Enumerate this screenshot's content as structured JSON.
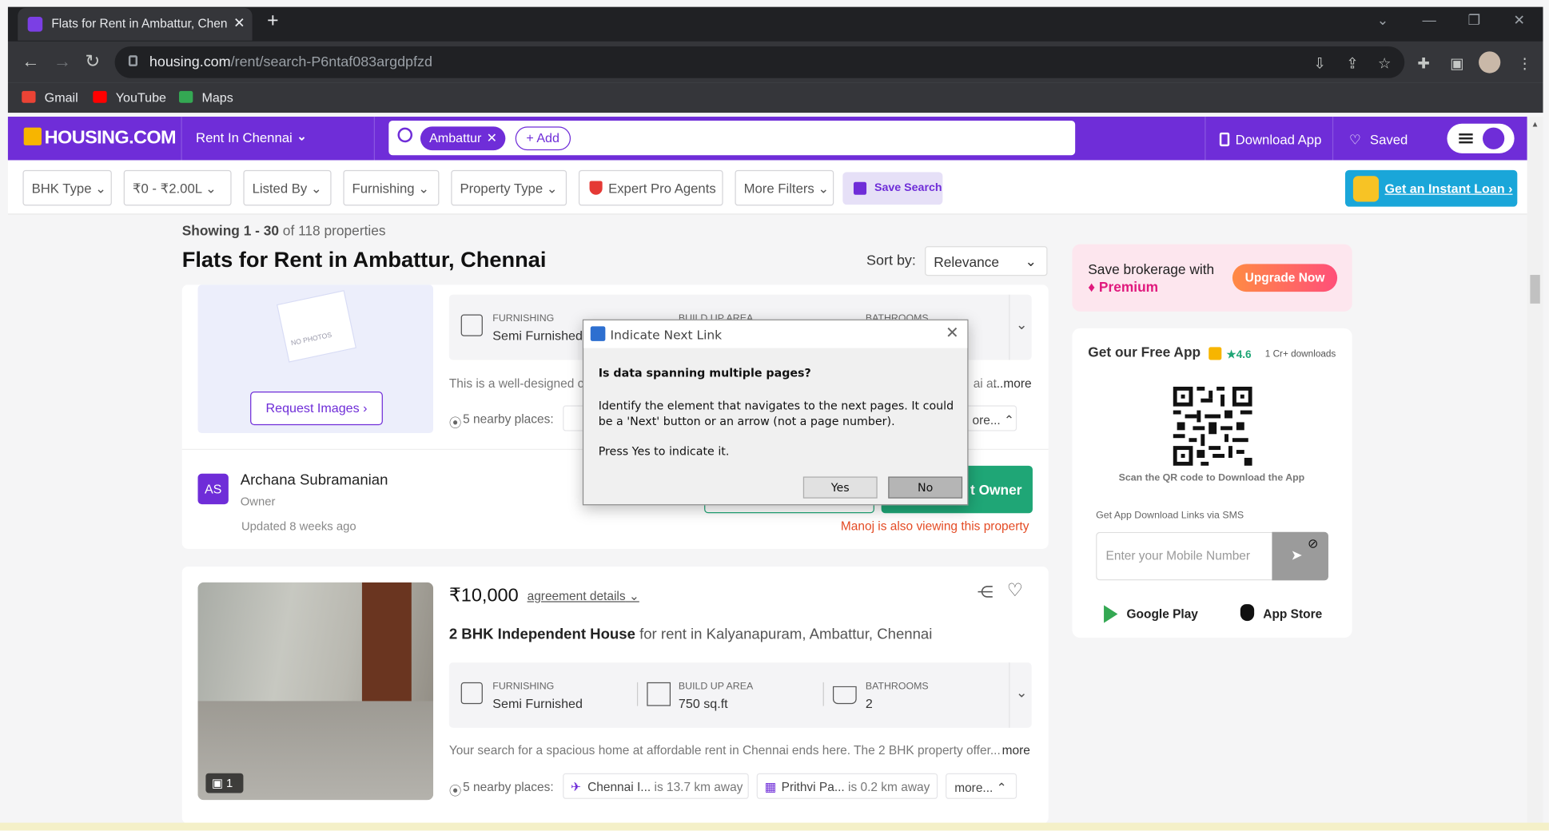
{
  "browser": {
    "tab_title": "Flats for Rent in Ambattur, Chenn",
    "url_host": "housing.com",
    "url_path": "/rent/search-P6ntaf083argdpfzd",
    "bookmarks": [
      "Gmail",
      "YouTube",
      "Maps"
    ]
  },
  "header": {
    "logo": "HOUSING.COM",
    "city": "Rent In Chennai",
    "search_chip": "Ambattur",
    "add_label": "+ Add",
    "download_app": "Download App",
    "saved": "Saved"
  },
  "filters": {
    "items": [
      "BHK Type",
      "₹0 - ₹2.00L",
      "Listed By",
      "Furnishing",
      "Property Type",
      "Expert Pro Agents",
      "More Filters"
    ],
    "save_search": "Save Search",
    "loan": "Get an Instant Loan ›"
  },
  "results": {
    "showing_range": "Showing 1 - 30",
    "showing_total": "of 118 properties",
    "title": "Flats for Rent in Ambattur, Chennai",
    "sort_label": "Sort by:",
    "sort_value": "Relevance"
  },
  "listing1": {
    "furnishing_label": "FURNISHING",
    "furnishing_value": "Semi Furnished",
    "area_label": "BUILD UP AREA",
    "bath_label": "BATHROOMS",
    "description": "This is a well-designed c",
    "desc_tail": "ai at",
    "more": "...more",
    "nearby": "5 nearby places:",
    "more_places": "ore...",
    "request_images": "Request Images ›",
    "no_photos": "NO PHOTOS",
    "owner_initials": "AS",
    "owner_name": "Archana Subramanian",
    "owner_role": "Owner",
    "updated": "Updated 8 weeks ago",
    "contact_label": "t Owner",
    "viewing": "Manoj is also viewing this property"
  },
  "listing2": {
    "photo_count": "1",
    "price": "₹10,000",
    "agreement": "agreement details",
    "title_bold": "2 BHK Independent House",
    "title_rest": " for rent in Kalyanapuram, Ambattur, Chennai",
    "furnishing_label": "FURNISHING",
    "furnishing_value": "Semi Furnished",
    "area_label": "BUILD UP AREA",
    "area_value": "750 sq.ft",
    "bath_label": "BATHROOMS",
    "bath_value": "2",
    "description": "Your search for a spacious home at affordable rent in Chennai ends here. The 2 BHK property offer...",
    "more": "more",
    "nearby": "5 nearby places:",
    "place1": "Chennai I...",
    "place1_dist": "is 13.7 km away",
    "place2": "Prithvi Pa...",
    "place2_dist": "is 0.2 km away",
    "more_places": "more..."
  },
  "sidebar": {
    "brokerage_text": "Save brokerage with",
    "premium": "Premium",
    "upgrade": "Upgrade Now",
    "free_app": "Get our Free App",
    "rating": "★4.6",
    "downloads": "1 Cr+ downloads",
    "scan_qr": "Scan the QR code to Download the App",
    "sms_label": "Get App Download Links via SMS",
    "mobile_placeholder": "Enter your Mobile Number",
    "google_play": "Google Play",
    "app_store": "App Store"
  },
  "dialog": {
    "title": "Indicate Next Link",
    "question": "Is data spanning multiple pages?",
    "body": "Identify the element that navigates to the next pages. It could be a 'Next' button or an arrow (not a page number).",
    "prompt": "Press Yes to indicate it.",
    "yes": "Yes",
    "no": "No"
  },
  "colors": {
    "brand": "#6f2dd8",
    "contact": "#1fa676",
    "alert": "#e44b24"
  }
}
